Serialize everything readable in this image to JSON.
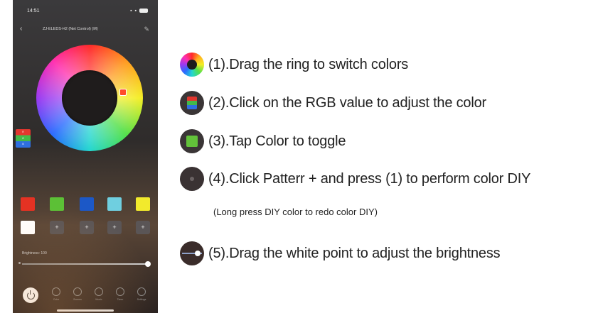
{
  "phone": {
    "status": {
      "time": "14:51",
      "signal": "▪ ▪"
    },
    "nav": {
      "title": "ZJ-ELEDS-H2 (Net Control) (M)"
    },
    "rgb_badge": [
      "R",
      "G",
      "B"
    ],
    "swatches": [
      {
        "color": "#e53223"
      },
      {
        "color": "#5cc036"
      },
      {
        "color": "#1c58c7"
      },
      {
        "color": "#6fcfe0"
      },
      {
        "color": "#f2ea2c"
      },
      {
        "color": "#ffffff"
      }
    ],
    "pattern_add_symbol": "+",
    "brightness": {
      "label": "Brightness: 100",
      "value": 1.0
    },
    "tabs": [
      "Color",
      "Scenes",
      "Music",
      "Timer",
      "Settings"
    ]
  },
  "instructions": [
    {
      "text": "(1).Drag the ring to switch colors",
      "icon": "color-ring-icon"
    },
    {
      "text": "(2).Click on the RGB value to adjust the color",
      "icon": "rgb-icon"
    },
    {
      "text": "(3).Tap Color to toggle",
      "icon": "green-swatch-icon"
    },
    {
      "text": "(4).Click Patterr  + and press (1) to perform color DIY",
      "icon": "pattern-add-icon"
    },
    {
      "text": "(5).Drag the white point to adjust the brightness",
      "icon": "brightness-slider-icon"
    }
  ],
  "note": "(Long press DIY color to redo color DIY)"
}
